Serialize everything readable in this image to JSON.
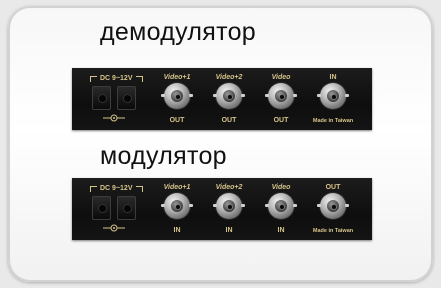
{
  "demodulator": {
    "title": "демодулятор",
    "power_label": "DC 9~12V",
    "ports": [
      {
        "top": "Video+1",
        "bottom": "OUT"
      },
      {
        "top": "Video+2",
        "bottom": "OUT"
      },
      {
        "top": "Video",
        "bottom": "OUT"
      },
      {
        "top": "IN",
        "bottom": "Made in Taiwan"
      }
    ]
  },
  "modulator": {
    "title": "модулятор",
    "power_label": "DC 9~12V",
    "ports": [
      {
        "top": "Video+1",
        "bottom": "IN"
      },
      {
        "top": "Video+2",
        "bottom": "IN"
      },
      {
        "top": "Video",
        "bottom": "IN"
      },
      {
        "top": "OUT",
        "bottom": "Made in Taiwan"
      }
    ]
  },
  "colors": {
    "panel": "#141414",
    "label_gold": "#d6c48a",
    "frame": "#f5f5f5"
  }
}
